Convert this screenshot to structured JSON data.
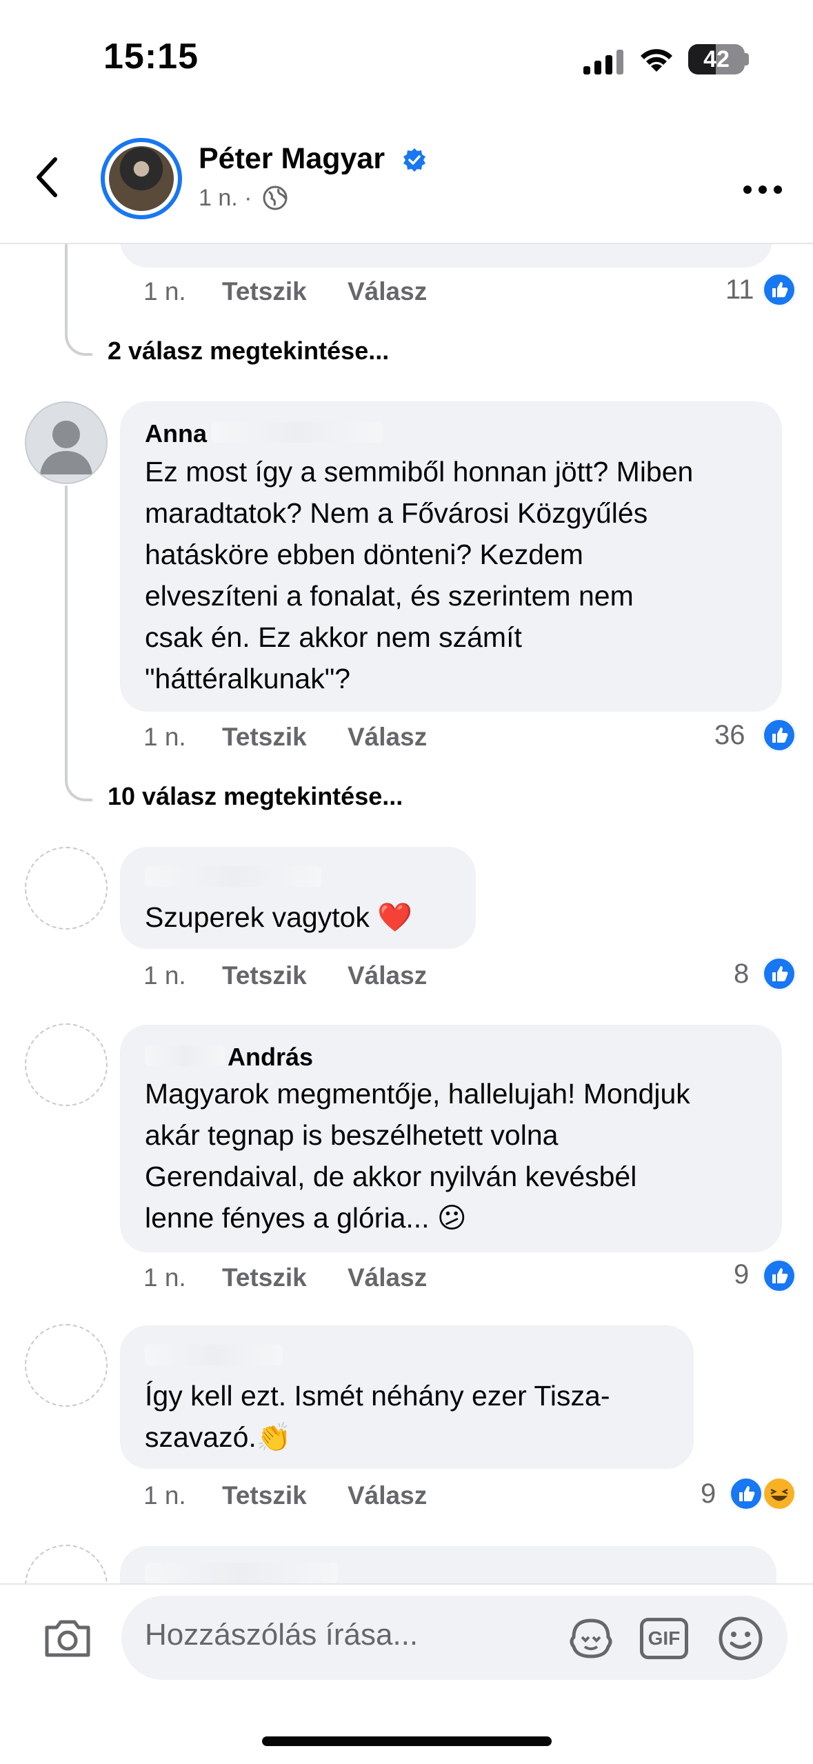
{
  "status_bar": {
    "time": "15:15",
    "battery": "42"
  },
  "header": {
    "name": "Péter Magyar",
    "meta": "1 n. ·"
  },
  "icons": {
    "back": "chevron-left-icon",
    "verified": "verified-badge-icon",
    "globe": "globe-icon",
    "more": "more-dots-icon",
    "camera": "camera-icon",
    "avatar_sticker": "avatar-sticker-icon",
    "gif": "gif-icon",
    "emoji": "emoji-icon",
    "like": "like-reaction-icon",
    "haha": "haha-reaction-icon"
  },
  "colors": {
    "accent": "#1877f2",
    "bubble": "#f0f2f5",
    "secondary_text": "#65676b"
  },
  "comments": [
    {
      "time": "1 n.",
      "like": "Tetszik",
      "reply": "Válasz",
      "count": "11",
      "replies": "2 válasz megtekintése..."
    },
    {
      "author": "Anna",
      "lines": [
        "Ez most így a semmiből honnan jött? Miben",
        "maradtatok? Nem a Fővárosi Közgyűlés",
        "hatásköre ebben dönteni? Kezdem",
        "elveszíteni a fonalat, és szerintem nem",
        "csak én. Ez akkor nem számít",
        "\"háttéralkunak\"?"
      ],
      "time": "1 n.",
      "like": "Tetszik",
      "reply": "Válasz",
      "count": "36",
      "replies": "10 válasz megtekintése..."
    },
    {
      "author": "",
      "lines": [
        "Szuperek vagytok ❤️"
      ],
      "time": "1 n.",
      "like": "Tetszik",
      "reply": "Válasz",
      "count": "8"
    },
    {
      "author": "András",
      "lines": [
        "Magyarok megmentője, hallelujah! Mondjuk",
        "akár tegnap is beszélhetett volna",
        "Gerendaival, de akkor nyilván kevésbél",
        "lenne fényes a glória... 😕"
      ],
      "time": "1 n.",
      "like": "Tetszik",
      "reply": "Válasz",
      "count": "9"
    },
    {
      "author": "",
      "lines": [
        "Így kell ezt. Ismét néhány ezer Tisza-",
        "szavazó.👏"
      ],
      "time": "1 n.",
      "like": "Tetszik",
      "reply": "Válasz",
      "count": "9"
    }
  ],
  "composer": {
    "placeholder": "Hozzászólás írása...",
    "gif": "GIF"
  }
}
